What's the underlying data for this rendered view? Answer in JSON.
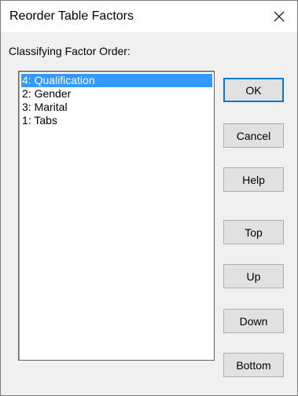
{
  "window": {
    "title": "Reorder Table Factors",
    "close_icon": "close-icon"
  },
  "dialog": {
    "prompt": "Classifying Factor Order:",
    "factors": [
      {
        "label": "4: Qualification",
        "selected": true
      },
      {
        "label": "2: Gender",
        "selected": false
      },
      {
        "label": "3: Marital",
        "selected": false
      },
      {
        "label": "1: Tabs",
        "selected": false
      }
    ],
    "buttons": {
      "ok": "OK",
      "cancel": "Cancel",
      "help": "Help",
      "top": "Top",
      "up": "Up",
      "down": "Down",
      "bottom": "Bottom"
    }
  },
  "colors": {
    "selection": "#3399ff",
    "default_button_border": "#0078d7",
    "dialog_background": "#f0f0f0"
  }
}
